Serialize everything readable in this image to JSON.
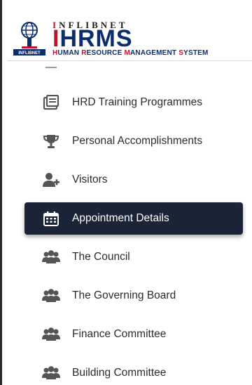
{
  "header": {
    "brand_top_first": "I",
    "brand_top_rest": "NFLIBNET",
    "brand_main_first": "I",
    "brand_main_rest": "HRMS",
    "brand_sub": [
      {
        "cap": "H",
        "rest": "UMAN "
      },
      {
        "cap": "R",
        "rest": "ESOURCE "
      },
      {
        "cap": "M",
        "rest": "ANAGEMENT "
      },
      {
        "cap": "S",
        "rest": "YSTEM"
      }
    ],
    "logo_caption": "INFLIBNET"
  },
  "menu": [
    {
      "label": "HRD Training Programmes",
      "icon": "list-doc-icon",
      "active": false
    },
    {
      "label": "Personal Accomplishments",
      "icon": "trophy-icon",
      "active": false
    },
    {
      "label": "Visitors",
      "icon": "user-plus-icon",
      "active": false
    },
    {
      "label": "Appointment Details",
      "icon": "calendar-icon",
      "active": true
    },
    {
      "label": "The Council",
      "icon": "users-icon",
      "active": false
    },
    {
      "label": "The Governing Board",
      "icon": "users-icon",
      "active": false
    },
    {
      "label": "Finance Committee",
      "icon": "users-icon",
      "active": false
    },
    {
      "label": "Building Committee",
      "icon": "users-icon",
      "active": false
    }
  ],
  "colors": {
    "active_bg": "#1a2436",
    "brand_blue": "#0c2d6b",
    "brand_red": "#c8102e",
    "icon_gray": "#555555"
  }
}
